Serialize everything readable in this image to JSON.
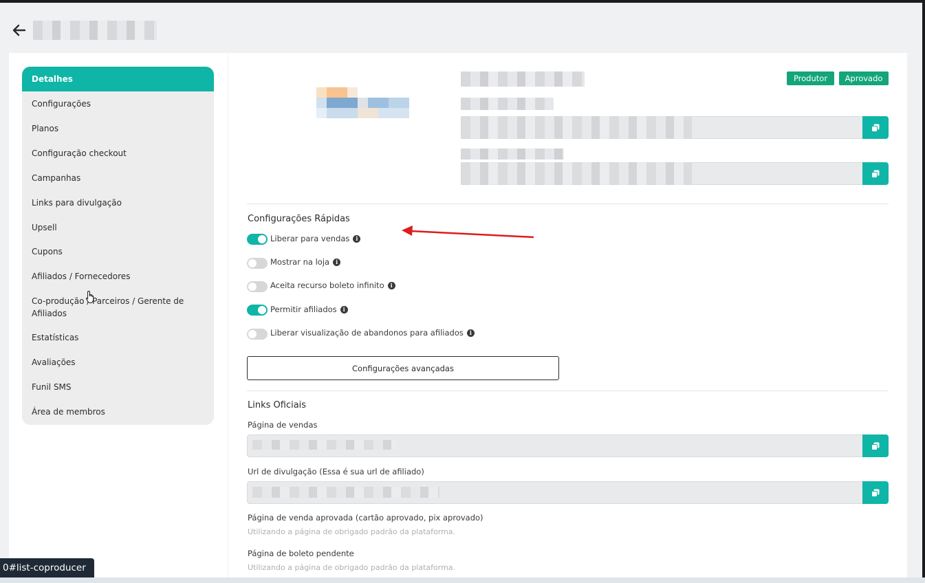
{
  "sidebar": {
    "items": [
      {
        "label": "Detalhes",
        "active": true
      },
      {
        "label": "Configurações"
      },
      {
        "label": "Planos"
      },
      {
        "label": "Configuração checkout"
      },
      {
        "label": "Campanhas"
      },
      {
        "label": "Links para divulgação"
      },
      {
        "label": "Upsell"
      },
      {
        "label": "Cupons"
      },
      {
        "label": "Afiliados / Fornecedores"
      },
      {
        "label": "Co-produção / Parceiros / Gerente de Afiliados"
      },
      {
        "label": "Estatísticas"
      },
      {
        "label": "Avaliações"
      },
      {
        "label": "Funil SMS"
      },
      {
        "label": "Área de membros"
      }
    ]
  },
  "badges": {
    "produtor": "Produtor",
    "aprovado": "Aprovado"
  },
  "quick_settings": {
    "title": "Configurações Rápidas",
    "toggles": [
      {
        "label": "Liberar para vendas",
        "on": true
      },
      {
        "label": "Mostrar na loja",
        "on": false
      },
      {
        "label": "Aceita recurso boleto infinito",
        "on": false
      },
      {
        "label": "Permitir afiliados",
        "on": true
      },
      {
        "label": "Liberar visualização de abandonos para afiliados",
        "on": false
      }
    ],
    "advanced_button": "Configurações avançadas"
  },
  "links": {
    "title": "Links Oficiais",
    "sales_page_label": "Página de vendas",
    "affiliate_url_label": "Url de divulgação (Essa é sua url de afiliado)",
    "approved_page_label": "Página de venda aprovada (cartão aprovado, pix aprovado)",
    "approved_page_hint": "Utilizando a página de obrigado padrão da plataforma.",
    "pending_boleto_label": "Página de boleto pendente",
    "pending_boleto_hint": "Utilizando a página de obrigado padrão da plataforma."
  },
  "status_bar": {
    "url_fragment": "0#list-coproducer"
  },
  "colors": {
    "accent": "#0fb5a6",
    "badge": "#14a57a",
    "annotation_arrow": "#e01b1b"
  },
  "icons": {
    "back": "arrow-left-icon",
    "copy": "copy-icon",
    "info": "info-icon",
    "cursor": "hand-cursor-icon"
  }
}
